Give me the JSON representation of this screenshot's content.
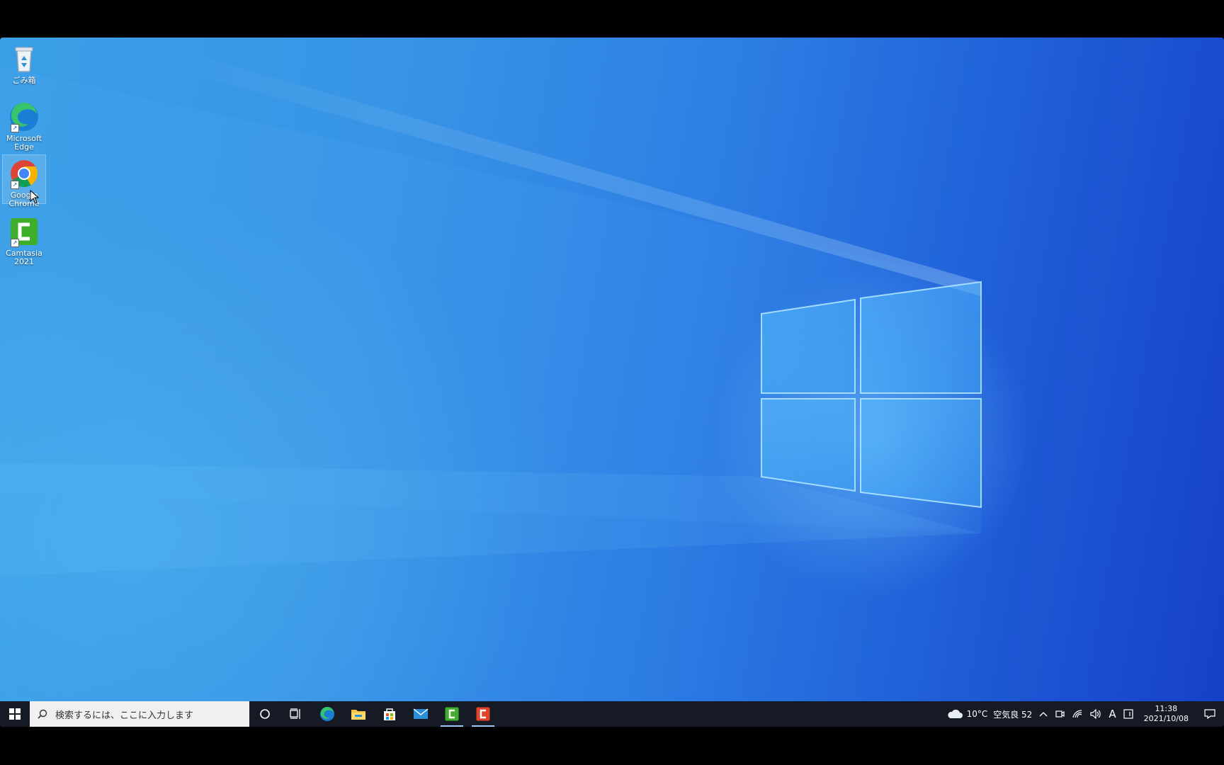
{
  "desktop": {
    "icons": [
      {
        "label_line1": "ごみ箱",
        "label_line2": "",
        "icon": "recycle-bin-icon"
      },
      {
        "label_line1": "Microsoft",
        "label_line2": "Edge",
        "icon": "edge-icon"
      },
      {
        "label_line1": "Google",
        "label_line2": "Chrome",
        "icon": "chrome-icon"
      },
      {
        "label_line1": "Camtasia",
        "label_line2": "2021",
        "icon": "camtasia-icon"
      }
    ]
  },
  "taskbar": {
    "search_placeholder": "検索するには、ここに入力します",
    "pinned": [
      "cortana-icon",
      "task-view-icon",
      "edge-icon",
      "file-explorer-icon",
      "store-icon",
      "mail-icon",
      "camtasia-icon",
      "camtasia-recorder-icon"
    ],
    "weather": {
      "temp": "10°C",
      "air": "空気良 52"
    },
    "ime": "A",
    "clock": {
      "time": "11:38",
      "date": "2021/10/08"
    }
  },
  "colors": {
    "taskbar_bg": "#151a25",
    "wallpaper_accent": "#2d7fe4"
  }
}
